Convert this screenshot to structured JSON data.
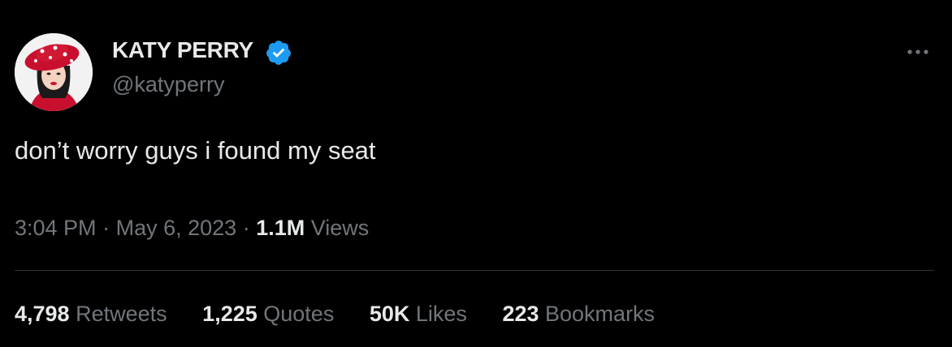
{
  "user": {
    "display_name": "KATY PERRY",
    "handle": "@katyperry",
    "verified_icon": "verified-badge-icon"
  },
  "tweet": {
    "text": "don’t worry guys i found my seat",
    "time": "3:04 PM",
    "separator": "·",
    "date": "May 6, 2023",
    "views_count": "1.1M",
    "views_label": "Views"
  },
  "stats": [
    {
      "count": "4,798",
      "label": "Retweets"
    },
    {
      "count": "1,225",
      "label": "Quotes"
    },
    {
      "count": "50K",
      "label": "Likes"
    },
    {
      "count": "223",
      "label": "Bookmarks"
    }
  ],
  "colors": {
    "background": "#000000",
    "primary_text": "#e7e9ea",
    "secondary_text": "#71767b",
    "verified_blue": "#1d9bf0",
    "divider": "#2f3336"
  },
  "icons": {
    "more": "more-horizontal-icon"
  }
}
